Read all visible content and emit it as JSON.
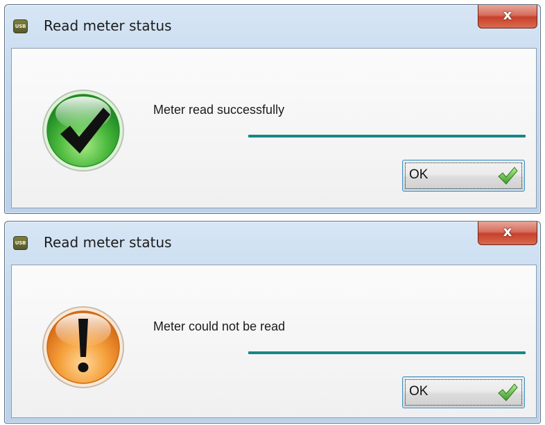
{
  "dialogs": [
    {
      "app_icon_text": "USB",
      "title": "Read meter status",
      "close_label": "x",
      "status_icon": "success-checkmark-icon",
      "message": "Meter read successfully",
      "ok_label": "OK",
      "progress": 1.0
    },
    {
      "app_icon_text": "USB",
      "title": "Read meter status",
      "close_label": "x",
      "status_icon": "warning-exclamation-icon",
      "message": "Meter could not be read",
      "ok_label": "OK",
      "progress": 1.0
    }
  ],
  "colors": {
    "success": "#3fb33a",
    "warning": "#f0922b",
    "progress": "#178786",
    "close": "#c7402b"
  }
}
